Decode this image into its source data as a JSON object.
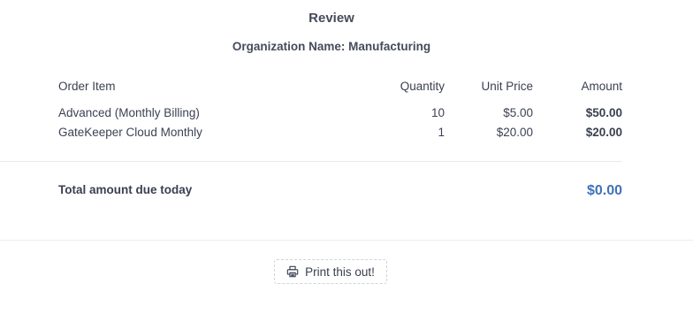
{
  "review": {
    "title": "Review",
    "organization_label": "Organization Name:",
    "organization_value": "Manufacturing"
  },
  "table": {
    "headers": {
      "item": "Order Item",
      "quantity": "Quantity",
      "unit_price": "Unit Price",
      "amount": "Amount"
    },
    "rows": [
      {
        "item": "Advanced (Monthly Billing)",
        "quantity": "10",
        "unit_price": "$5.00",
        "amount": "$50.00"
      },
      {
        "item": "GateKeeper Cloud Monthly",
        "quantity": "1",
        "unit_price": "$20.00",
        "amount": "$20.00"
      }
    ]
  },
  "total": {
    "label": "Total amount due today",
    "value": "$0.00",
    "value_color": "#3f72b8"
  },
  "actions": {
    "print_label": "Print this out!",
    "print_icon": "printer-icon"
  }
}
